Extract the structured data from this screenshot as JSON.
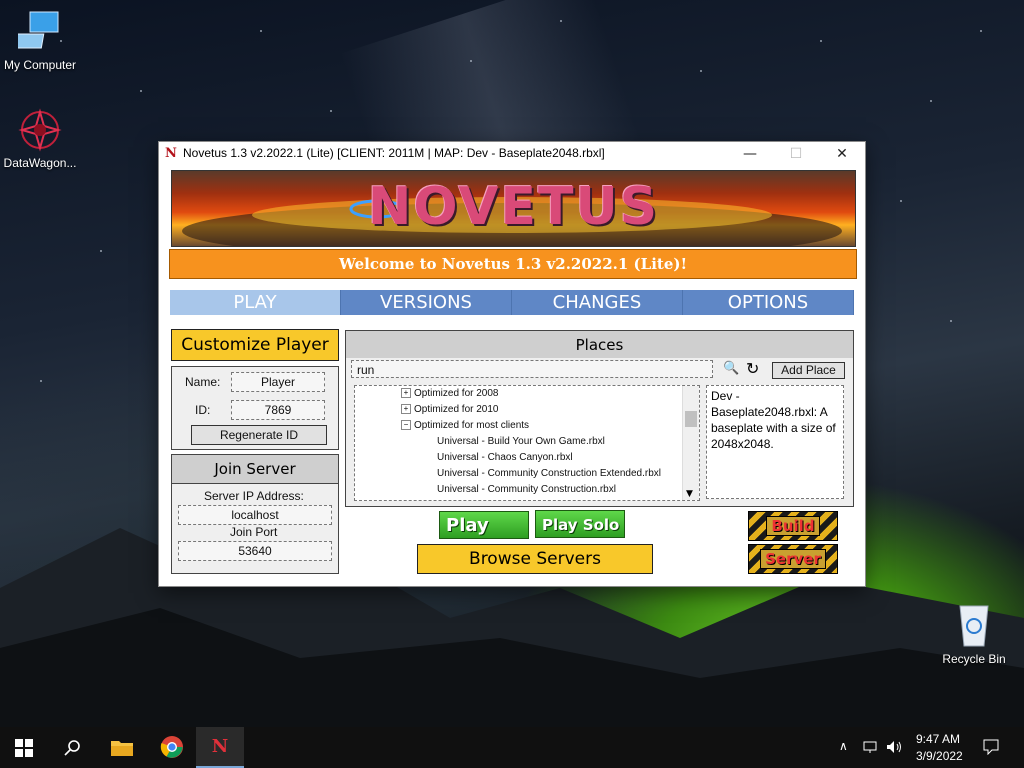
{
  "desktop": {
    "icons": [
      {
        "label": "My Computer"
      },
      {
        "label": "DataWagon..."
      },
      {
        "label": "Recycle Bin"
      }
    ]
  },
  "window": {
    "title": "Novetus 1.3 v2.2022.1 (Lite) [CLIENT: 2011M | MAP: Dev - Baseplate2048.rbxl]",
    "icon_letter": "N",
    "controls": {
      "minimize": "—",
      "maximize": "☐",
      "close": "✕"
    },
    "banner_text": "NOVETUS",
    "welcome": "Welcome to Novetus 1.3 v2.2022.1 (Lite)!",
    "tabs": [
      {
        "label": "PLAY",
        "active": true
      },
      {
        "label": "VERSIONS",
        "active": false
      },
      {
        "label": "CHANGES",
        "active": false
      },
      {
        "label": "OPTIONS",
        "active": false
      }
    ],
    "customize_button": "Customize Player",
    "player": {
      "name_label": "Name:",
      "name_value": "Player",
      "id_label": "ID:",
      "id_value": "7869",
      "regenerate_button": "Regenerate ID"
    },
    "join": {
      "header": "Join Server",
      "ip_label": "Server IP Address:",
      "ip_value": "localhost",
      "port_label": "Join Port",
      "port_value": "53640"
    },
    "places": {
      "header": "Places",
      "search_value": "run",
      "add_place_button": "Add Place",
      "tree": [
        {
          "text": "Optimized for 2008",
          "level": 0,
          "expander": "+"
        },
        {
          "text": "Optimized for 2010",
          "level": 0,
          "expander": "+"
        },
        {
          "text": "Optimized for most clients",
          "level": 0,
          "expander": "−"
        },
        {
          "text": "Universal - Build Your Own Game.rbxl",
          "level": 1
        },
        {
          "text": "Universal - Chaos Canyon.rbxl",
          "level": 1
        },
        {
          "text": "Universal - Community Construction Extended.rbxl",
          "level": 1
        },
        {
          "text": "Universal - Community Construction.rbxl",
          "level": 1
        }
      ],
      "description": "Dev - Baseplate2048.rbxl: A baseplate with a size of 2048x2048."
    },
    "buttons": {
      "play": "Play",
      "play_solo": "Play Solo",
      "browse_servers": "Browse Servers",
      "build": "Build",
      "server": "Server"
    }
  },
  "taskbar": {
    "time": "9:47 AM",
    "date": "3/9/2022"
  }
}
